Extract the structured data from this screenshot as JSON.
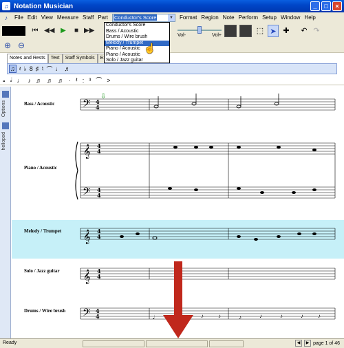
{
  "window": {
    "title": "Notation Musician"
  },
  "menu": {
    "items_left": [
      "File",
      "Edit",
      "View",
      "Measure",
      "Staff",
      "Part"
    ],
    "part_select_value": "Conductor's Score",
    "items_right": [
      "Format",
      "Region",
      "Note",
      "Perform",
      "Setup",
      "Window",
      "Help"
    ]
  },
  "toolbar": {
    "vol_low": "Vol-",
    "vol_high": "Vol+",
    "volume_level": 0.5
  },
  "part_dropdown": {
    "options": [
      "Conductor's Score",
      "Bass / Acoustic",
      "Drums / Wire brush",
      "Melody / Trumpet",
      "Piano / Acoustic",
      "Piano / Acoustic",
      "Solo / Jazz guitar"
    ],
    "selected_index": 3
  },
  "palette": {
    "tabs": [
      "Notes and Rests",
      "Text",
      "Staff Symbols",
      "Expre"
    ],
    "active_tab": 0
  },
  "sidebar": {
    "labels": [
      "Options",
      "hellopod"
    ]
  },
  "score": {
    "instruments": [
      "Bass / Acoustic",
      "Piano / Acoustic",
      "Melody / Trumpet",
      "Solo / Jazz guitar",
      "Drums / Wire brush"
    ],
    "time_signature": "4/4",
    "highlighted_instrument": "Melody / Trumpet"
  },
  "statusbar": {
    "status": "Ready",
    "page": "page 1 of 46"
  },
  "colors": {
    "titlebar": "#0046c8",
    "highlight": "#c6f0f8",
    "selection": "#316ac5",
    "arrow": "#c0281c"
  }
}
